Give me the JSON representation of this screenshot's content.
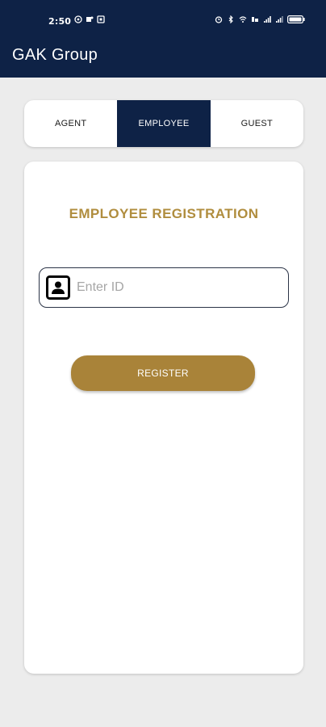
{
  "status_bar": {
    "time": "2:50",
    "left_icons": [
      "whatsapp-icon",
      "teams-icon",
      "notification-icon"
    ],
    "right_icons": [
      "alarm-icon",
      "bluetooth-icon",
      "wifi-icon",
      "volte-icon",
      "signal-icon",
      "signal-icon",
      "battery-icon"
    ]
  },
  "app_bar": {
    "title": "GAK Group"
  },
  "tabs": [
    {
      "label": "AGENT",
      "active": false
    },
    {
      "label": "EMPLOYEE",
      "active": true
    },
    {
      "label": "GUEST",
      "active": false
    }
  ],
  "form": {
    "title": "EMPLOYEE REGISTRATION",
    "id_field": {
      "placeholder": "Enter ID",
      "value": "",
      "icon": "contact-card-icon"
    },
    "register_label": "REGISTER"
  },
  "colors": {
    "primary_navy": "#0e2246",
    "accent_gold": "#a98339",
    "title_gold": "#b08d3e",
    "background": "#ececec"
  }
}
